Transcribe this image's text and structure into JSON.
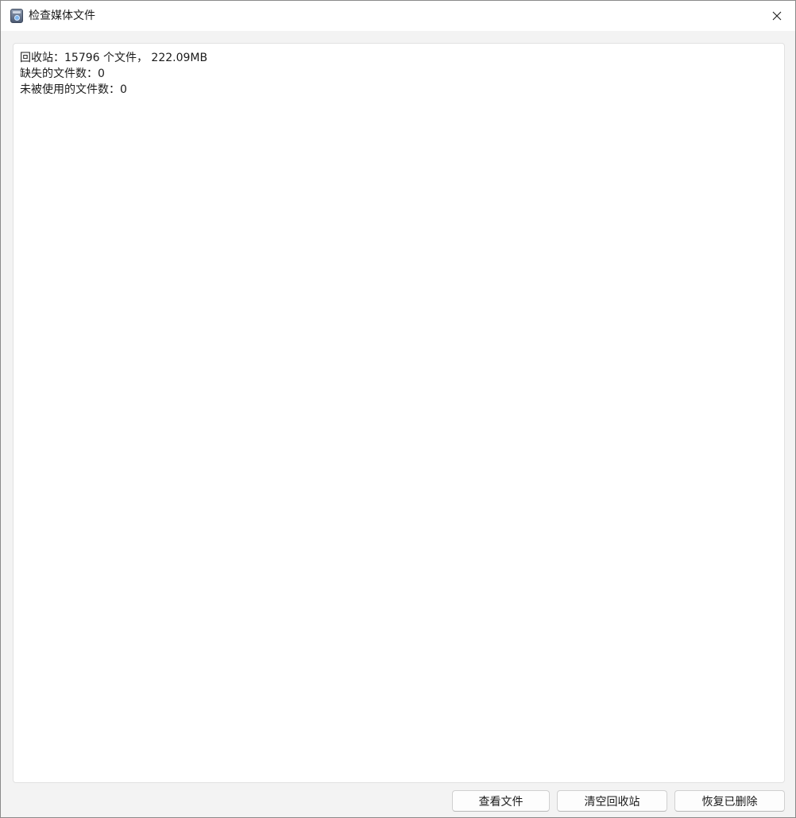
{
  "window": {
    "title": "检查媒体文件",
    "icon": "app-icon",
    "close_icon": "close-icon"
  },
  "info": {
    "lines": [
      "回收站：15796 个文件， 222.09MB",
      "缺失的文件数：0",
      "未被使用的文件数：0"
    ]
  },
  "buttons": {
    "view_files": "查看文件",
    "empty_trash": "清空回收站",
    "restore_deleted": "恢复已删除"
  },
  "colors": {
    "window_bg": "#f3f3f3",
    "panel_bg": "#ffffff",
    "text": "#1b1b1b"
  }
}
